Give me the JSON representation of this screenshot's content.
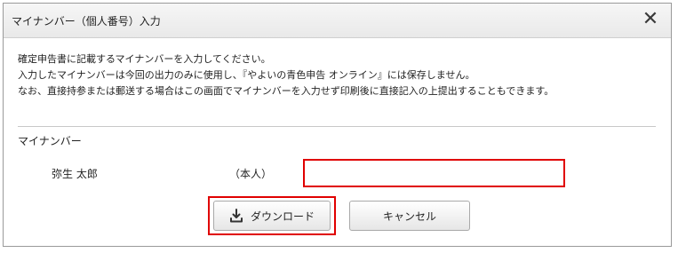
{
  "dialog": {
    "title": "マイナンバー（個人番号）入力",
    "close_symbol": "✕"
  },
  "description": {
    "line1": "確定申告書に記載するマイナンバーを入力してください。",
    "line2": "入力したマイナンバーは今回の出力のみに使用し、『やよいの青色申告 オンライン』には保存しません。",
    "line3": "なお、直接持参または郵送する場合はこの画面でマイナンバーを入力せず印刷後に直接記入の上提出することもできます。"
  },
  "mynumber": {
    "section_label": "マイナンバー",
    "person_name": "弥生 太郎",
    "relation": "（本人）",
    "input_value": ""
  },
  "buttons": {
    "download_label": "ダウンロード",
    "cancel_label": "キャンセル"
  },
  "icons": {
    "download": "download-icon",
    "close": "close-icon"
  },
  "colors": {
    "highlight": "#e00000"
  }
}
